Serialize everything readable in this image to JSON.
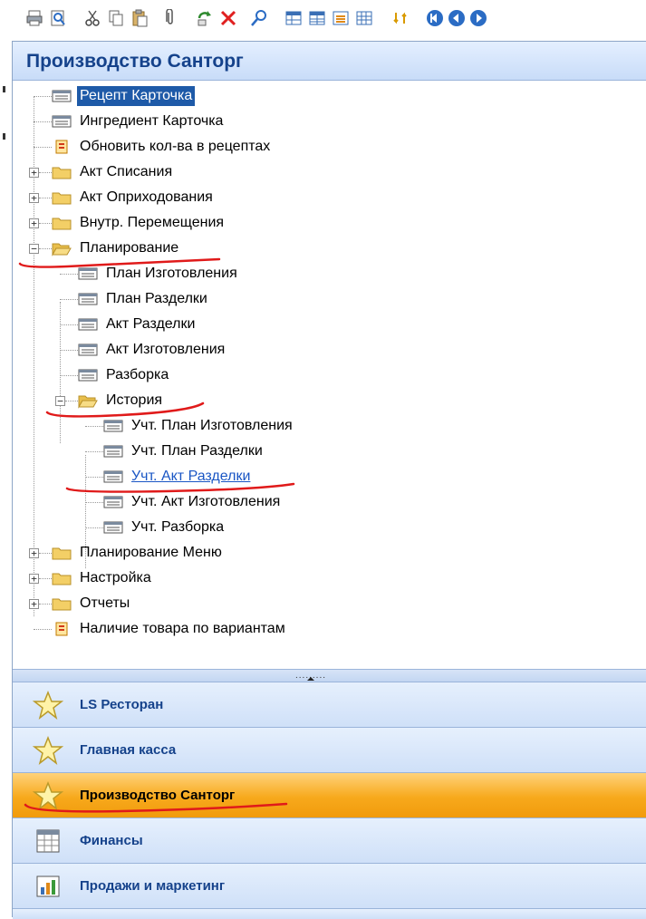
{
  "toolbar": {
    "icons": [
      "print-icon",
      "preview-icon",
      "cut-icon",
      "copy-icon",
      "paste-icon",
      "attach-icon",
      "refresh-icon",
      "delete-icon",
      "find-icon",
      "grid-icon",
      "grid-alt-icon",
      "filter-icon",
      "table-icon",
      "sync-icon",
      "first-icon",
      "prev-icon",
      "next-icon"
    ]
  },
  "nav": {
    "header_title": "Производство Санторг",
    "tree": {
      "recept": "Рецепт Карточка",
      "ingredient": "Ингредиент Карточка",
      "update_qty": "Обновить кол-ва в рецептах",
      "writeoff": "Акт Списания",
      "income": "Акт Оприходования",
      "transfer": "Внутр. Перемещения",
      "planning": "Планирование",
      "plan_make": "План Изготовления",
      "plan_split": "План Разделки",
      "act_split": "Акт Разделки",
      "act_make": "Акт Изготовления",
      "disassembly": "Разборка",
      "history": "История",
      "hist_plan_make": "Учт. План Изготовления",
      "hist_plan_split": "Учт. План Разделки",
      "hist_act_split": "Учт. Акт Разделки",
      "hist_act_make": "Учт. Акт Изготовления",
      "hist_disassembly": "Учт. Разборка",
      "menu_planning": "Планирование Меню",
      "settings": "Настройка",
      "reports": "Отчеты",
      "stock_by_variant": "Наличие товара по вариантам"
    },
    "splitter_dots": ".........",
    "buttons": {
      "ls_restaurant": "LS Ресторан",
      "main_cash": "Главная касса",
      "production": "Производство Санторг",
      "finance": "Финансы",
      "sales": "Продажи и маркетинг"
    }
  },
  "colors": {
    "header_text": "#15428b",
    "selection": "#1e5aa8",
    "active_button": "#f7a91c",
    "annotation_red": "#e01a1a",
    "link": "#1a56c4"
  }
}
